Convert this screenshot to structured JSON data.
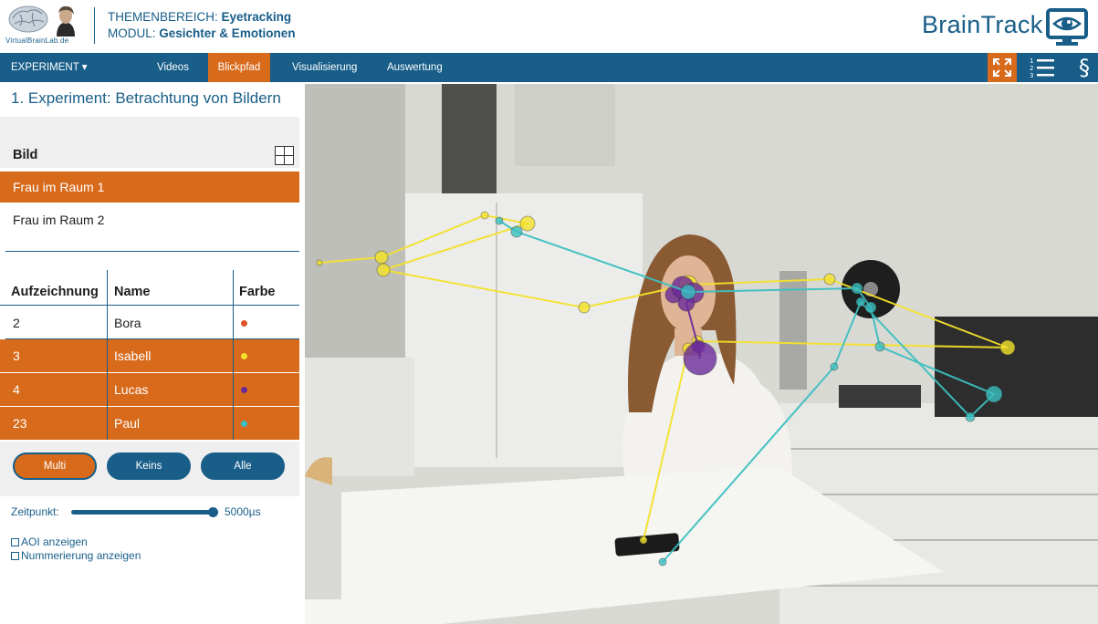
{
  "header": {
    "logo_text": "VirtualBrainLab.de",
    "theme_label": "THEMENBEREICH:",
    "theme_value": "Eyetracking",
    "module_label": "MODUL:",
    "module_value": "Gesichter & Emotionen",
    "brand": "BrainTrack"
  },
  "nav": {
    "experiment": "EXPERIMENT ▾",
    "videos": "Videos",
    "blickpfad": "Blickpfad",
    "visualisierung": "Visualisierung",
    "auswertung": "Auswertung"
  },
  "panel": {
    "title": "1. Experiment: Betrachtung von Bildern",
    "bild_header": "Bild",
    "images": [
      "Frau im Raum 1",
      "Frau im Raum 2"
    ],
    "selected_image": "Frau im Raum 1",
    "table_headers": {
      "recording": "Aufzeichnung",
      "name": "Name",
      "color": "Farbe"
    },
    "recordings": [
      {
        "id": "2",
        "name": "Bora",
        "color": "#e0532a",
        "selected": false
      },
      {
        "id": "3",
        "name": "Isabell",
        "color": "#f2e22b",
        "selected": true
      },
      {
        "id": "4",
        "name": "Lucas",
        "color": "#6a2b9a",
        "selected": true
      },
      {
        "id": "23",
        "name": "Paul",
        "color": "#3bbfc0",
        "selected": true
      }
    ],
    "buttons": {
      "multi": "Multi",
      "keins": "Keins",
      "alle": "Alle"
    },
    "time_label": "Zeitpunkt:",
    "time_value": "5000µs",
    "time_fraction": 1.0,
    "checkbox_aoi": "AOI anzeigen",
    "checkbox_numbering": "Nummerierung anzeigen",
    "checkbox_aoi_checked": false,
    "checkbox_numbering_checked": false
  },
  "colors": {
    "primary": "#185e89",
    "accent": "#d86a1b",
    "gaze_yellow": "#f2e22b",
    "gaze_purple": "#6a2b9a",
    "gaze_cyan": "#3bbfc0"
  },
  "icons": {
    "logo": "brain-logo-icon",
    "portrait": "portrait-icon",
    "brand": "eye-monitor-icon",
    "fullscreen": "fullscreen-icon",
    "list": "numbered-list-icon",
    "legal": "paragraph-icon"
  }
}
